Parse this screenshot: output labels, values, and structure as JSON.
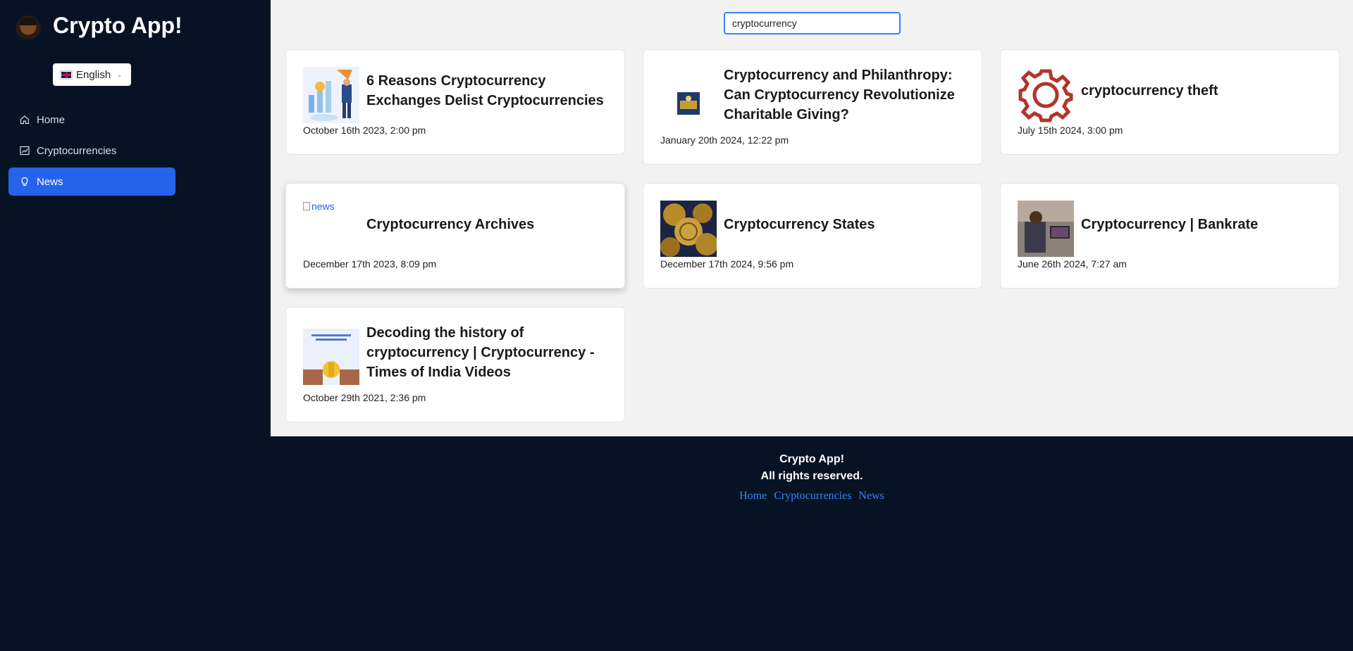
{
  "app": {
    "title": "Crypto App!"
  },
  "language": {
    "selected": "English"
  },
  "nav": {
    "items": [
      {
        "label": "Home",
        "icon": "home-icon"
      },
      {
        "label": "Cryptocurrencies",
        "icon": "chart-icon"
      },
      {
        "label": "News",
        "icon": "bulb-icon",
        "active": true
      }
    ]
  },
  "search": {
    "value": "cryptocurrency"
  },
  "news": [
    {
      "title_1": "6 Reasons Cryptocurrency",
      "title_2": "Exchanges Delist Cryptocurrencies",
      "date": "October 16th 2023, 2:00 pm"
    },
    {
      "title_1": "Cryptocurrency and Philanthropy:",
      "title_2": "Can Cryptocurrency Revolutionize",
      "title_3": "Charitable Giving?",
      "date": "January 20th 2024, 12:22 pm"
    },
    {
      "title_1": "cryptocurrency theft",
      "date": "July 15th 2024, 3:00 pm"
    },
    {
      "title_1": "Cryptocurrency Archives",
      "alt": "news",
      "date": "December 17th 2023, 8:09 pm"
    },
    {
      "title_1": "Cryptocurrency States",
      "date": "December 17th 2024, 9:56 pm"
    },
    {
      "title_1": "Cryptocurrency | Bankrate",
      "date": "June 26th 2024, 7:27 am"
    },
    {
      "title_1": "Decoding the history of",
      "title_2": "cryptocurrency | Cryptocurrency -",
      "title_3": "Times of India Videos",
      "date": "October 29th 2021, 2:36 pm"
    }
  ],
  "footer": {
    "line1": "Crypto App!",
    "line2": "All rights reserved.",
    "links": [
      "Home",
      "Cryptocurrencies",
      "News"
    ]
  },
  "colors": {
    "sidebar_bg": "#071324",
    "accent": "#2563eb",
    "main_bg": "#f2f2f2"
  }
}
